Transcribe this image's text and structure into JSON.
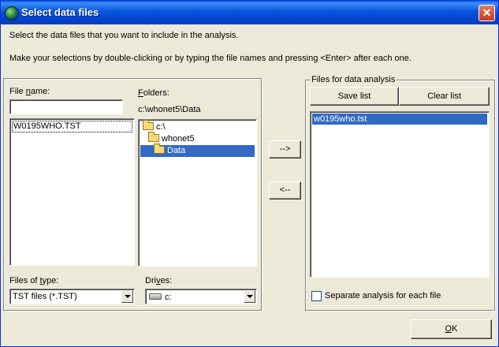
{
  "window": {
    "title": "Select data files",
    "close_glyph": "✕",
    "app_icon": "globe-icon"
  },
  "instructions": {
    "line1": "Select the data files that you want to include in the analysis.",
    "line2": "Make your selections by double-clicking or by typing the file names and pressing <Enter> after each one."
  },
  "file_name": {
    "label_pre": "File ",
    "label_ul": "n",
    "label_post": "ame:",
    "value": "",
    "files": [
      "W0195WHO.TST"
    ]
  },
  "folders": {
    "label_ul": "F",
    "label_post": "olders:",
    "current_path": "c:\\whonet5\\Data",
    "items": [
      {
        "label": "c:\\",
        "selected": false
      },
      {
        "label": "whonet5",
        "selected": false
      },
      {
        "label": "Data",
        "selected": true
      }
    ]
  },
  "files_of_type": {
    "label_pre": "Files of ",
    "label_ul": "t",
    "label_post": "ype:",
    "selected": "TST files (*.TST)"
  },
  "drives": {
    "label_pre": "Dri",
    "label_ul": "v",
    "label_post": "es:",
    "selected": "c:"
  },
  "move_buttons": {
    "add": "-->",
    "remove": "<--"
  },
  "analysis_group": {
    "title": "Files for data analysis",
    "save_list": "Save list",
    "clear_list": "Clear list",
    "selected_files": [
      "w0195who.tst"
    ],
    "separate_label": "Separate analysis for each file",
    "separate_checked": false
  },
  "ok_button": {
    "label_ul": "O",
    "label_post": "K"
  },
  "colors": {
    "selection": "#316ac5",
    "dialog_bg": "#ece9d8",
    "titlebar": "#0855dd"
  }
}
